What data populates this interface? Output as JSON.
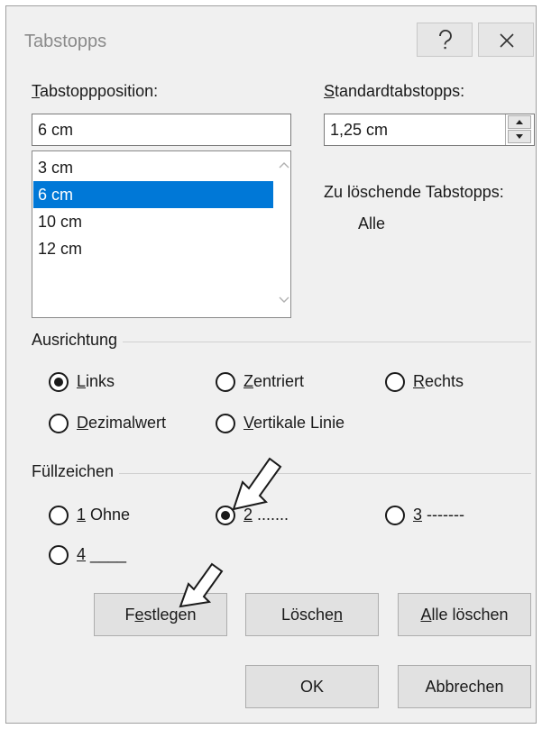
{
  "window": {
    "title": "Tabstopps"
  },
  "titlebar": {
    "help_icon": "question-icon",
    "close_icon": "close-icon"
  },
  "tabstop_position": {
    "label_accel": "T",
    "label_rest": "abstoppposition:",
    "value": "6 cm",
    "list": [
      "3 cm",
      "6 cm",
      "10 cm",
      "12 cm"
    ],
    "selected": "6 cm"
  },
  "default_tabs": {
    "label_accel": "S",
    "label_rest": "tandardtabstopps:",
    "value": "1,25 cm"
  },
  "to_delete": {
    "label": "Zu löschende Tabstopps:",
    "value": "Alle"
  },
  "alignment": {
    "title": "Ausrichtung",
    "options": [
      {
        "accel": "L",
        "rest": "inks"
      },
      {
        "accel": "Z",
        "rest": "entriert"
      },
      {
        "accel": "R",
        "rest": "echts"
      },
      {
        "accel": "D",
        "rest": "ezimalwert"
      },
      {
        "accel": "V",
        "rest": "ertikale Linie"
      }
    ],
    "selected": "Links"
  },
  "leader": {
    "title": "Füllzeichen",
    "options": [
      {
        "accel": "1",
        "rest": " Ohne"
      },
      {
        "accel": "2",
        "rest": " ......."
      },
      {
        "accel": "3",
        "rest": " -------"
      },
      {
        "accel": "4",
        "rest": " ____"
      }
    ],
    "selected": "2"
  },
  "buttons": {
    "set": {
      "pre": "F",
      "accel": "e",
      "post": "stlegen"
    },
    "clear": {
      "pre": "Lösche",
      "accel": "n",
      "post": ""
    },
    "clear_all": {
      "pre": "",
      "accel": "A",
      "post": "lle löschen"
    },
    "ok": "OK",
    "cancel": "Abbrechen"
  },
  "annotations": {
    "arrow_icon": "pointer-arrow-icon"
  }
}
